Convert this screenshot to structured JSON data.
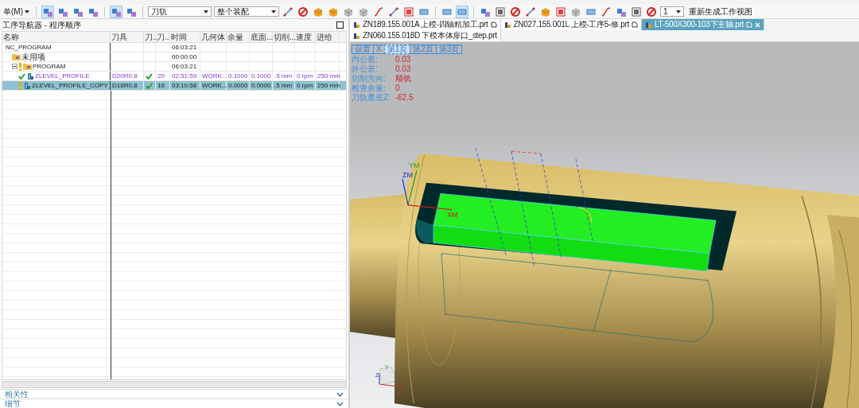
{
  "toolbar": {
    "menu": "单(M)",
    "toggle_groups": [
      [
        {
          "pressed": true
        },
        {
          "pressed": false
        },
        {
          "pressed": false
        },
        {
          "pressed": false
        }
      ],
      [
        {
          "pressed": true
        },
        {
          "pressed": false
        }
      ]
    ],
    "display_toggles": [
      {
        "pressed": false
      },
      {
        "pressed": true
      }
    ],
    "path_filter": "刀轨",
    "scope_filter": "整个装配",
    "layer_value": "1",
    "regenerate_button": "重新生成工作视图"
  },
  "navigator": {
    "title": "工序导航器 - 程序顺序",
    "columns": [
      "名称",
      "刀具",
      "刀..",
      "刀..",
      "时间",
      "几何体",
      "余量",
      "底面...",
      "切削...",
      "速度",
      "进给"
    ],
    "rows": [
      {
        "cells": [
          "NC_PROGRAM",
          "",
          "",
          "",
          "06:03:21",
          "",
          "",
          "",
          "",
          "",
          ""
        ],
        "selected": false,
        "children": [
          {
            "kind": "group",
            "cells": [
              "未用项",
              "",
              "",
              "",
              "00:00:00",
              "",
              "",
              "",
              "",
              "",
              ""
            ],
            "selected": false
          },
          {
            "kind": "group",
            "expanded": true,
            "cells": [
              "PROGRAM",
              "",
              "",
              "",
              "06:03:21",
              "",
              "",
              "",
              "",
              "",
              ""
            ],
            "selected": false,
            "children": [
              {
                "kind": "operation",
                "complete": true,
                "emphasized": true,
                "tool_ok": true,
                "cells": [
                  "ZLEVEL_PROFILE",
                  "D20R0.8",
                  "",
                  "20",
                  "02:51:59",
                  "WORK...",
                  "0.1000",
                  "0.1000",
                  ".5 mm",
                  "0 rpm",
                  "250 mm"
                ],
                "selected": false
              },
              {
                "kind": "operation",
                "complete": false,
                "emphasized": false,
                "tool_ok": true,
                "cells": [
                  "ZLEVEL_PROFILE_COPY",
                  "D16R0.8",
                  "",
                  "16",
                  "03:10:58",
                  "WORK...",
                  "0.0000",
                  "0.0000",
                  ".5 mm",
                  "0 rpm",
                  "250 mm"
                ],
                "selected": true
              }
            ]
          }
        ]
      }
    ],
    "sections": [
      {
        "label": "相关性",
        "expanded": false
      },
      {
        "label": "细节",
        "expanded": false
      }
    ]
  },
  "tabs": [
    {
      "label": "ZN189.155.001A 上模-四轴精加工.prt",
      "modified": true,
      "selected": false
    },
    {
      "label": "ZN027.155.001L 上模-工序5-修.prt",
      "modified": true,
      "selected": false
    },
    {
      "label": "LT-500X300-103下主轴.prt",
      "modified": true,
      "selected": true
    },
    {
      "label": "ZN060.155.018D 下模本体扉口_step.prt",
      "modified": false,
      "selected": false
    }
  ],
  "info_panel": {
    "buttons": [
      {
        "label": "设置",
        "selected": false
      },
      {
        "label": "X",
        "selected": false
      },
      {
        "label": "第1页",
        "selected": true
      },
      {
        "label": "第2页",
        "selected": false
      },
      {
        "label": "第3页",
        "selected": false
      }
    ],
    "items": [
      {
        "label": "内公差:",
        "value": "0.03"
      },
      {
        "label": "外公差:",
        "value": "0.03"
      },
      {
        "label": "切削方向:",
        "value": "顺铣"
      },
      {
        "label": "检查余量:",
        "value": "0"
      },
      {
        "label": "刀轨最底Z:",
        "value": "-62.5"
      }
    ]
  },
  "viewport": {
    "wcs_labels": [
      "YM",
      "ZM",
      "XM"
    ],
    "triad_labels": [
      "Y",
      "Z",
      "X"
    ]
  }
}
